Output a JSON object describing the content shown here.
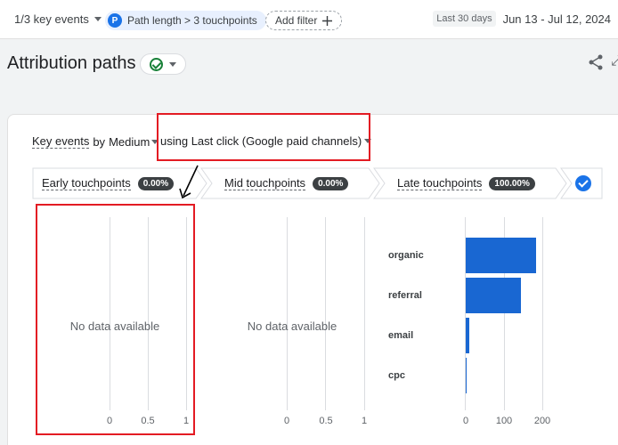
{
  "topbar": {
    "key_events": "1/3 key events",
    "filter_chip_letter": "P",
    "filter_chip": "Path length > 3 touchpoints",
    "add_filter": "Add filter",
    "date_label": "Last 30 days",
    "date_range": "Jun 13 - Jul 12, 2024"
  },
  "page": {
    "title": "Attribution paths"
  },
  "controls": {
    "key_events": "Key events",
    "by": "by",
    "dimension": "Medium",
    "model": "using Last click (Google paid channels)"
  },
  "steps": [
    {
      "label": "Early touchpoints",
      "value": "0.00%"
    },
    {
      "label": "Mid touchpoints",
      "value": "0.00%"
    },
    {
      "label": "Late touchpoints",
      "value": "100.00%"
    }
  ],
  "panels": {
    "early": {
      "message": "No data available",
      "ticks": [
        "0",
        "0.5",
        "1"
      ]
    },
    "mid": {
      "message": "No data available",
      "ticks": [
        "0",
        "0.5",
        "1"
      ]
    }
  },
  "chart_data": {
    "type": "bar",
    "orientation": "horizontal",
    "categories": [
      "organic",
      "referral",
      "email",
      "cpc"
    ],
    "values": [
      183,
      145,
      9,
      1
    ],
    "xlim": [
      0,
      200
    ],
    "ticks": [
      "0",
      "100",
      "200"
    ],
    "color": "#1967d2"
  },
  "colors": {
    "accent": "#1a73e8",
    "bar": "#1967d2",
    "annotation": "#e31b23",
    "success": "#188038"
  }
}
